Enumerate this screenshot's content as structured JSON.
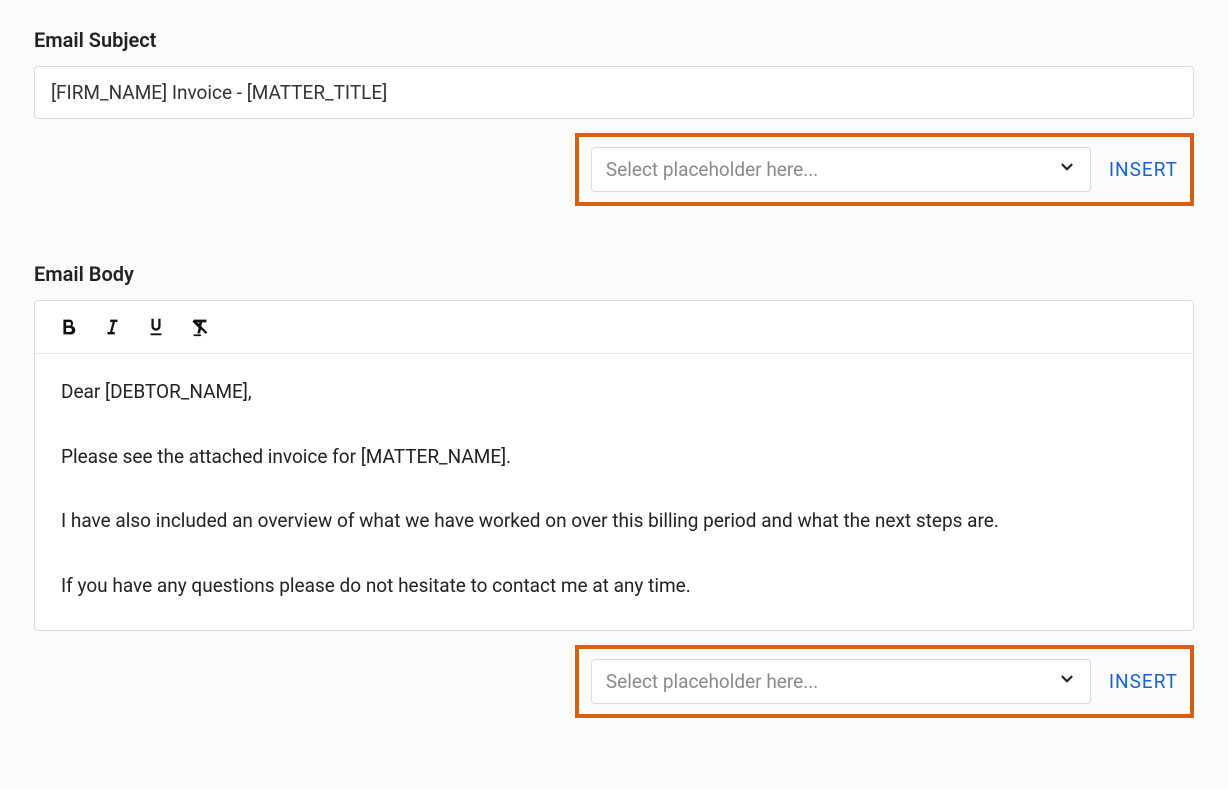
{
  "subject": {
    "label": "Email Subject",
    "value": "[FIRM_NAME] Invoice - [MATTER_TITLE]",
    "placeholder_select_text": "Select placeholder here...",
    "insert_label": "INSERT"
  },
  "body": {
    "label": "Email Body",
    "placeholder_select_text": "Select placeholder here...",
    "insert_label": "INSERT",
    "lines": [
      "Dear [DEBTOR_NAME],",
      "",
      "Please see the attached invoice for [MATTER_NAME].",
      "",
      "I have also included an overview of what we have worked on over this billing period and what the next steps are.",
      "",
      "If you have any questions please do not hesitate to contact me at any time."
    ]
  },
  "icons": {
    "bold": "bold-icon",
    "italic": "italic-icon",
    "underline": "underline-icon",
    "clear": "clear-format-icon",
    "chevron": "chevron-down-icon"
  }
}
